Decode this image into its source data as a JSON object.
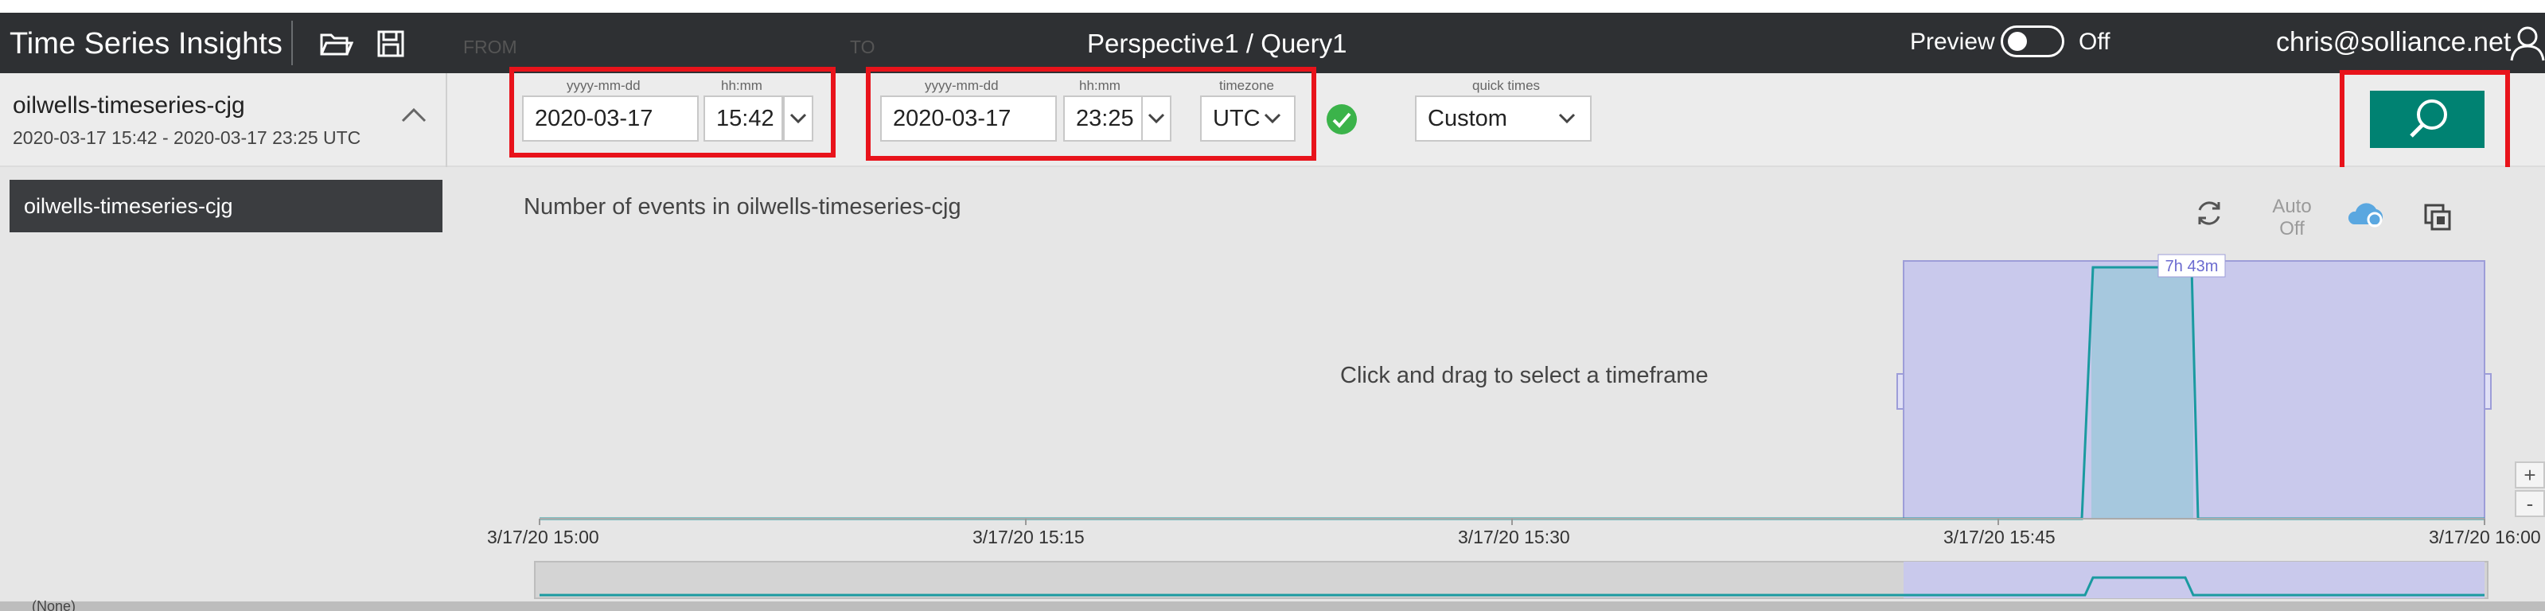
{
  "header": {
    "app_title": "Time Series Insights",
    "center_title": "Perspective1 / Query1",
    "preview_label": "Preview",
    "preview_state": "Off",
    "user": "chris@solliance.net"
  },
  "environment": {
    "name": "oilwells-timeseries-cjg",
    "range": "2020-03-17 15:42  -  2020-03-17 23:25 UTC",
    "list_item": "oilwells-timeseries-cjg"
  },
  "query": {
    "from_label": "FROM",
    "to_label": "TO",
    "date_caption": "yyyy-mm-dd",
    "time_caption": "hh:mm",
    "timezone_caption": "timezone",
    "quick_times_caption": "quick times",
    "from_date": "2020-03-17",
    "from_time": "15:42",
    "to_date": "2020-03-17",
    "to_time": "23:25",
    "timezone": "UTC",
    "quick_times": "Custom"
  },
  "chart": {
    "title": "Number of events in oilwells-timeseries-cjg",
    "auto_label_1": "Auto",
    "auto_label_2": "Off",
    "hint": "Click and drag to select a timeframe",
    "brush_label": "7h 43m",
    "zoom_in": "+",
    "zoom_out": "-",
    "ticks": [
      "3/17/20 15:00",
      "3/17/20 15:15",
      "3/17/20 15:30",
      "3/17/20 15:45",
      "3/17/20 16:00"
    ]
  },
  "bottom": {
    "none_label": "(None)"
  },
  "colors": {
    "topbar": "#2e3033",
    "accent": "#008272",
    "highlight": "#e8131b",
    "series": "#1a9aa0",
    "selection": "#c9c9ec"
  }
}
